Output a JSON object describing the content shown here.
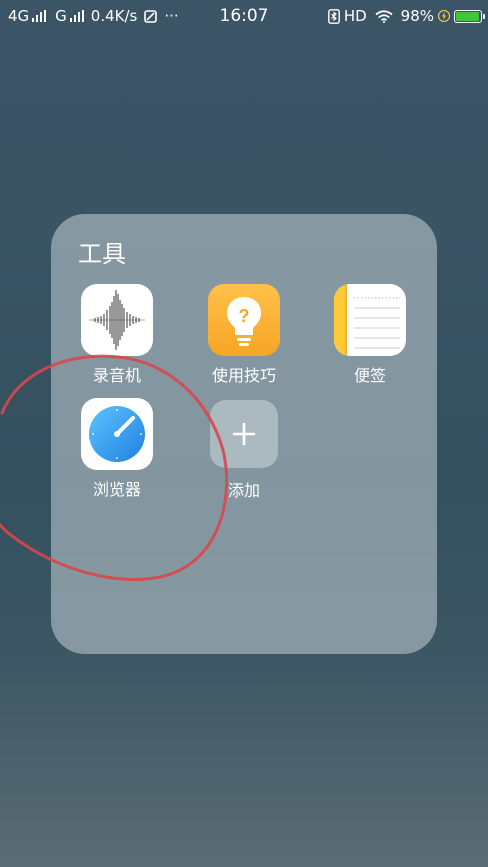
{
  "status_bar": {
    "network1": "4G",
    "network2": "G",
    "speed": "0.4K/s",
    "more": "···",
    "time": "16:07",
    "hd": "HD",
    "battery": "98%",
    "battery_level": 0.98,
    "battery_color": "#3ec63e"
  },
  "folder": {
    "title": "工具",
    "apps": [
      {
        "label": "录音机",
        "icon": "waveform-icon"
      },
      {
        "label": "使用技巧",
        "icon": "lightbulb-icon"
      },
      {
        "label": "便签",
        "icon": "notes-icon"
      },
      {
        "label": "浏览器",
        "icon": "compass-icon"
      },
      {
        "label": "添加",
        "icon": "plus-icon"
      }
    ]
  },
  "colors": {
    "tips_icon": "#f7a524",
    "browser_icon": "#2f8ee6",
    "annotation_stroke": "#d8474b"
  }
}
